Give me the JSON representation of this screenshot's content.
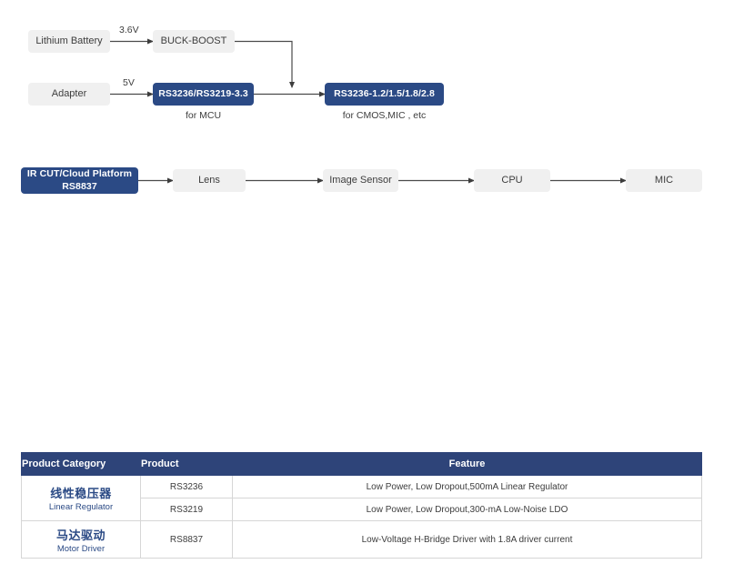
{
  "diagram": {
    "nodes": [
      {
        "id": "lithium-battery",
        "label": "Lithium Battery",
        "style": "gray"
      },
      {
        "id": "buck-boost",
        "label": "BUCK-BOOST",
        "style": "gray"
      },
      {
        "id": "adapter",
        "label": "Adapter",
        "style": "gray"
      },
      {
        "id": "rs3236-rs3219-33",
        "label": "RS3236/RS3219-3.3",
        "style": "blue"
      },
      {
        "id": "rs3236-multi",
        "label": "RS3236-1.2/1.5/1.8/2.8",
        "style": "blue"
      },
      {
        "id": "ir-cut-cloud-platform",
        "label": "IR CUT/Cloud Platform",
        "label2": "RS8837",
        "style": "blue"
      },
      {
        "id": "lens",
        "label": "Lens",
        "style": "gray"
      },
      {
        "id": "image-sensor",
        "label": "Image Sensor",
        "style": "gray"
      },
      {
        "id": "cpu",
        "label": "CPU",
        "style": "gray"
      },
      {
        "id": "mic",
        "label": "MIC",
        "style": "gray"
      }
    ],
    "voltage_labels": [
      {
        "id": "battery-voltage",
        "value": "3.6V"
      },
      {
        "id": "adapter-voltage",
        "value": "5V"
      }
    ],
    "captions": [
      {
        "id": "caption-mcu",
        "text": "for MCU"
      },
      {
        "id": "caption-cmos",
        "text": "for CMOS,MIC , etc"
      }
    ]
  },
  "table": {
    "headers": {
      "category": "Product Category",
      "product": "Product",
      "feature": "Feature"
    },
    "groups": [
      {
        "category_cn": "线性稳压器",
        "category_en": "Linear Regulator",
        "rows": [
          {
            "product": "RS3236",
            "feature": "Low Power, Low Dropout,500mA Linear Regulator"
          },
          {
            "product": "RS3219",
            "feature": "Low Power, Low Dropout,300-mA Low-Noise LDO"
          }
        ]
      },
      {
        "category_cn": "马达驱动",
        "category_en": "Motor Driver",
        "rows": [
          {
            "product": "RS8837",
            "feature": "Low-Voltage H-Bridge Driver with 1.8A driver current"
          }
        ]
      }
    ]
  },
  "colors": {
    "accent_blue": "#2b4a85",
    "table_header_blue": "#2e4479",
    "node_gray": "#f0f0f0",
    "line": "#4a4a4a"
  }
}
